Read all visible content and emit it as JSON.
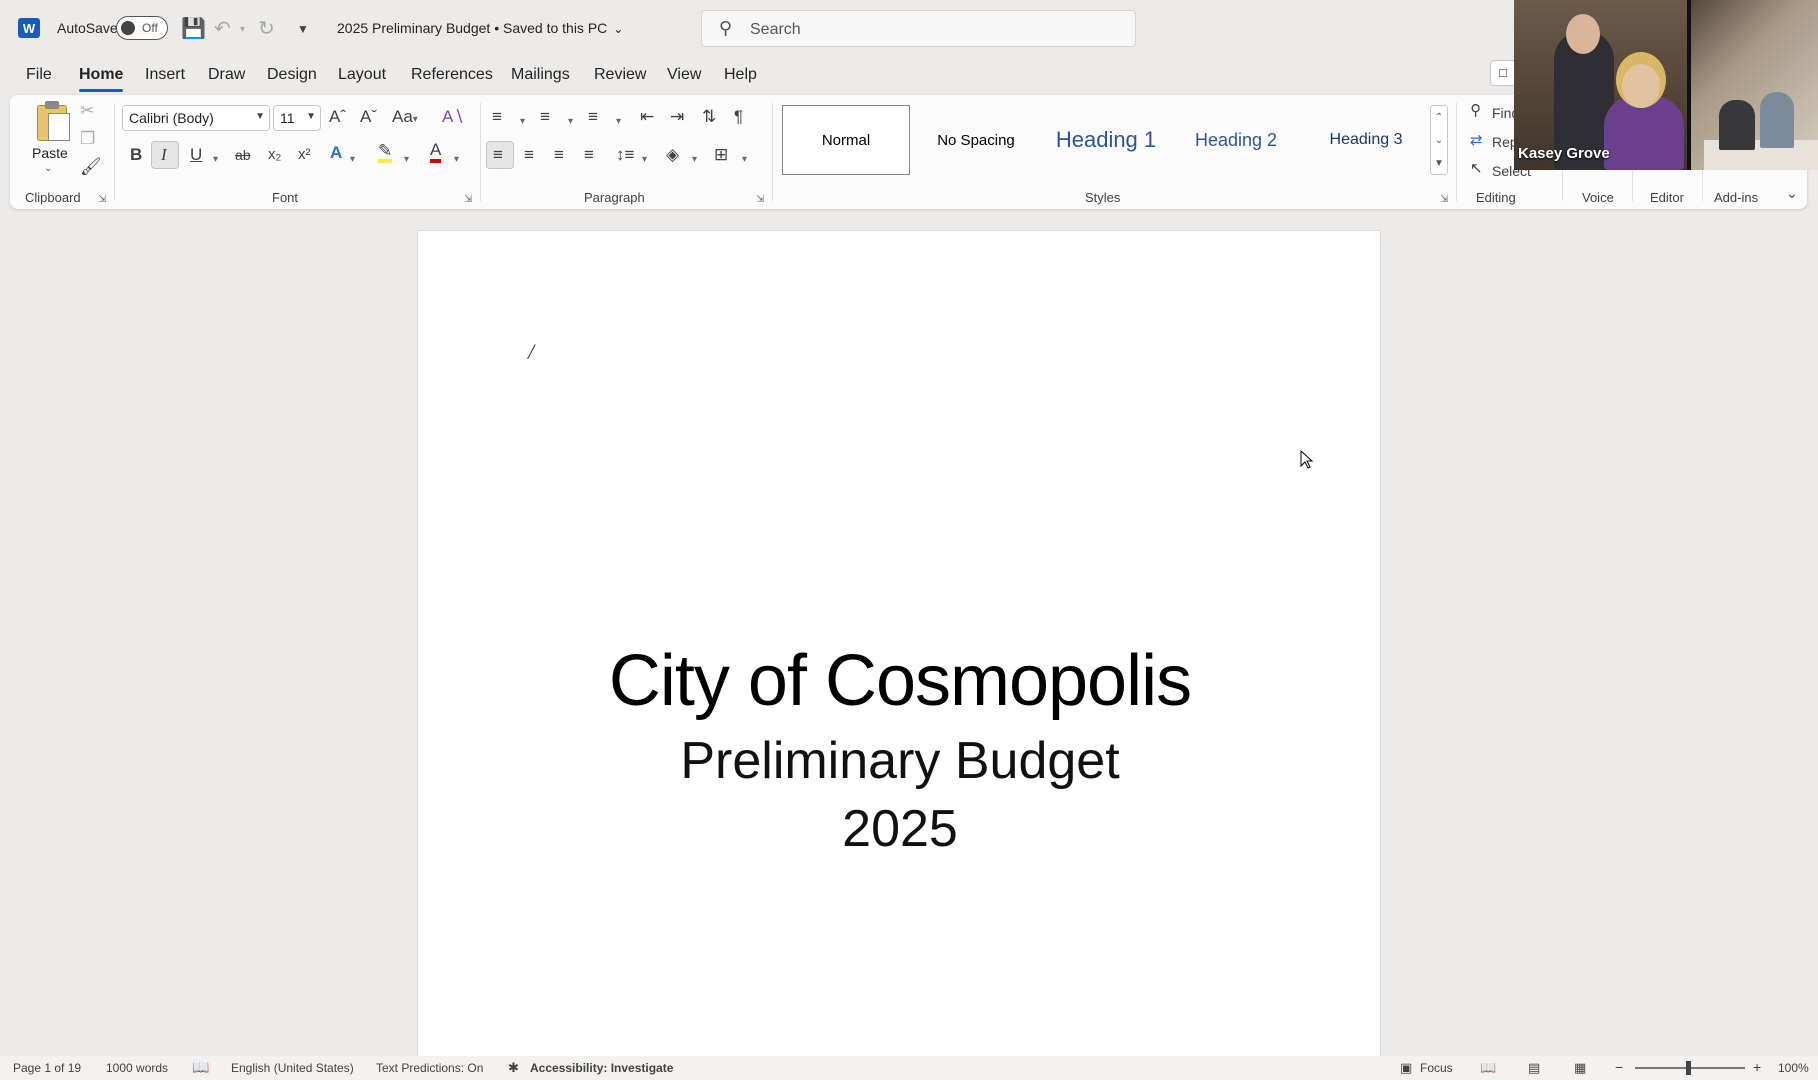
{
  "titlebar": {
    "autosave_label": "AutoSave",
    "autosave_state": "Off",
    "document_title": "2025 Preliminary Budget • Saved to this PC",
    "search_placeholder": "Search"
  },
  "tabs": [
    "File",
    "Home",
    "Insert",
    "Draw",
    "Design",
    "Layout",
    "References",
    "Mailings",
    "Review",
    "View",
    "Help"
  ],
  "active_tab": "Home",
  "ribbon": {
    "clipboard": {
      "label": "Clipboard",
      "paste": "Paste"
    },
    "font": {
      "label": "Font",
      "family": "Calibri (Body)",
      "size": "11"
    },
    "paragraph": {
      "label": "Paragraph"
    },
    "styles": {
      "label": "Styles",
      "items": [
        "Normal",
        "No Spacing",
        "Heading 1",
        "Heading 2",
        "Heading 3"
      ],
      "selected": "Normal"
    },
    "editing": {
      "label": "Editing",
      "find": "Find",
      "replace": "Rep",
      "select": "Select"
    },
    "voice": {
      "label": "Voice"
    },
    "editor": {
      "label": "Editor"
    },
    "addins": {
      "label": "Add-ins"
    }
  },
  "document": {
    "caret_glyph": "/",
    "title": "City of Cosmopolis",
    "subtitle": "Preliminary Budget",
    "year": "2025"
  },
  "video": {
    "participant_name": "Kasey Grove"
  },
  "statusbar": {
    "page": "Page 1 of 19",
    "words": "1000 words",
    "language": "English (United States)",
    "text_predictions": "Text Predictions: On",
    "accessibility": "Accessibility: Investigate",
    "focus": "Focus",
    "zoom": "100%"
  },
  "colors": {
    "accent": "#185abd",
    "save_icon": "#8a3fb6",
    "highlight": "#ffeb3b",
    "font_color": "#d00000"
  }
}
